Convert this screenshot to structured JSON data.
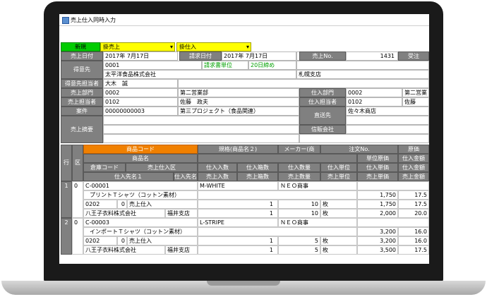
{
  "window": {
    "title": "売上仕入同時入力"
  },
  "toolbar": {
    "new_label": "新規",
    "sales_type": "掛売上",
    "purchase_type": "掛仕入"
  },
  "header": {
    "sales_date_label": "売上日付",
    "sales_date": "2017年 7月17日",
    "billing_date_label": "請求日付",
    "billing_date": "2017年 7月17日",
    "sales_no_label": "売上No.",
    "sales_no": "1431",
    "order_label": "受注",
    "customer_label": "得意先",
    "customer_code": "0001",
    "billing_unit": "請求書単位",
    "closing": "20日締め",
    "customer_name": "太平洋食品株式会社",
    "branch": "札幌支店",
    "customer_rep_label": "得意先担当者",
    "customer_rep": "大木　誠",
    "sales_dept_label": "売上部門",
    "sales_dept_code": "0002",
    "sales_dept_name": "第二営業部",
    "purchase_dept_label": "仕入部門",
    "purchase_dept_code": "0002",
    "purchase_dept_name": "第二営業",
    "sales_staff_label": "売上担当者",
    "sales_staff_code": "0102",
    "sales_staff_name": "佐藤　政夫",
    "purchase_staff_label": "仕入担当者",
    "purchase_staff_code": "0102",
    "purchase_staff_name": "佐藤",
    "project_label": "案件",
    "project_code": "00000000003",
    "project_name": "第三プロジェクト（食品関連）",
    "ship_to_label": "直送先",
    "ship_to": "佐々木商店",
    "memo_label": "売上摘要",
    "trust_label": "信販会社"
  },
  "grid": {
    "h_row": "行",
    "h_kubun": "区",
    "h_product_code": "商品コード",
    "h_spec": "規格(商品名２)",
    "h_maker": "メーカー(商",
    "h_order_no": "注文No.",
    "h_cost": "原価",
    "h_product_name": "商品名",
    "h_unit_cost": "単位原価",
    "h_cost_amount": "仕入金額",
    "h_warehouse": "倉庫コード",
    "h_sales_purchase_kubun": "売上仕入区",
    "h_purchase_unit_price": "仕入単価",
    "h_qty_per_case_in": "仕入入数",
    "h_cases_in": "仕入箱数",
    "h_qty_in": "仕入数量",
    "h_unit_in": "仕入単位",
    "h_supplier1": "仕入先名１",
    "h_supplier2": "仕入先名２",
    "h_qty_per_case_out": "売上入数",
    "h_cases_out": "売上箱数",
    "h_qty_out": "売上数量",
    "h_unit_out": "売上単位",
    "h_sales_unit_price": "売上単価",
    "h_sales_amount": "売上金額",
    "rows": [
      {
        "no": "1",
        "kubun": "0",
        "code": "C-00001",
        "spec": "M-WHITE",
        "maker": "ＮＥＯ商事",
        "name": "プリントＴシャツ（コットン素材）",
        "unit_cost": "1,750",
        "cost_amount": "17.5",
        "warehouse": "0202",
        "wh_kubun": "0",
        "sp_kubun": "売上仕入",
        "qty_in": "1",
        "qty_amt_in": "10",
        "unit_in": "枚",
        "price_in": "1,750",
        "amt_in": "17.5",
        "supplier1": "八王子衣料株式会社",
        "supplier2": "福井支店",
        "qty_out": "1",
        "qty_amt_out": "10",
        "unit_out": "枚",
        "price_out": "2,000",
        "amt_out": "20.0"
      },
      {
        "no": "2",
        "kubun": "0",
        "code": "C-00003",
        "spec": "L-STRIPE",
        "maker": "ＮＥＯ商事",
        "name": "インポートＴシャツ（コットン素材）",
        "unit_cost": "3,200",
        "cost_amount": "16.0",
        "warehouse": "0202",
        "wh_kubun": "0",
        "sp_kubun": "売上仕入",
        "qty_in": "1",
        "qty_amt_in": "5",
        "unit_in": "枚",
        "price_in": "3,200",
        "amt_in": "16.0",
        "supplier1": "八王子衣料株式会社",
        "supplier2": "福井支店",
        "qty_out": "1",
        "qty_amt_out": "5",
        "unit_out": "枚",
        "price_out": "3,500",
        "amt_out": "17.5"
      }
    ]
  }
}
